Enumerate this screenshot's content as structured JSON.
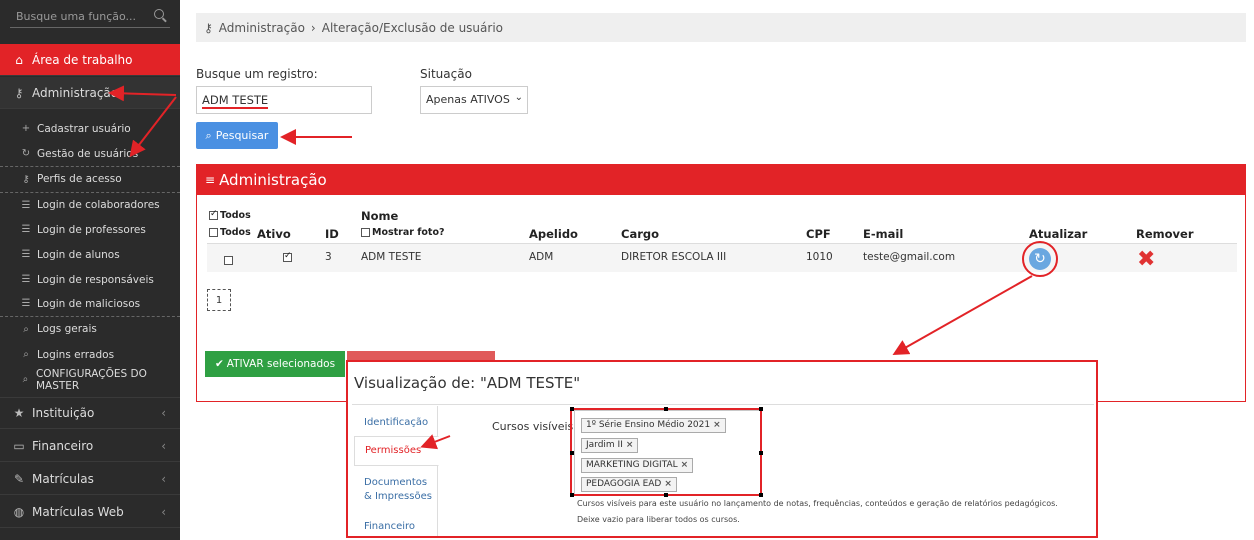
{
  "sidebar": {
    "search_placeholder": "Busque uma função...",
    "items": [
      {
        "label": "Área de trabalho"
      },
      {
        "label": "Administração"
      }
    ],
    "sub_items": [
      {
        "label": "Cadastrar usuário"
      },
      {
        "label": "Gestão de usuários"
      },
      {
        "label": "Perfis de acesso"
      },
      {
        "label": "Login de colaboradores"
      },
      {
        "label": "Login de professores"
      },
      {
        "label": "Login de alunos"
      },
      {
        "label": "Login de responsáveis"
      },
      {
        "label": "Login de maliciosos"
      },
      {
        "label": "Logs gerais"
      },
      {
        "label": "Logins errados"
      },
      {
        "label": "CONFIGURAÇÕES DO MASTER"
      }
    ],
    "bottom_items": [
      {
        "label": "Instituição"
      },
      {
        "label": "Financeiro"
      },
      {
        "label": "Matrículas"
      },
      {
        "label": "Matrículas Web"
      }
    ]
  },
  "breadcrumb": {
    "part1": "Administração",
    "sep": "›",
    "part2": "Alteração/Exclusão de usuário"
  },
  "search": {
    "label": "Busque um registro:",
    "value": "ADM TESTE",
    "button": "Pesquisar"
  },
  "situacao": {
    "label": "Situação",
    "selected": "Apenas ATIVOS"
  },
  "panel": {
    "title": "Administração"
  },
  "table": {
    "todos_top": "Todos",
    "todos": "Todos",
    "headers": {
      "ativo": "Ativo",
      "id": "ID",
      "nome": "Nome",
      "mostrar_foto": "Mostrar foto?",
      "apelido": "Apelido",
      "cargo": "Cargo",
      "cpf": "CPF",
      "email": "E-mail",
      "atualizar": "Atualizar",
      "remover": "Remover"
    },
    "rows": [
      {
        "id": "3",
        "nome": "ADM TESTE",
        "apelido": "ADM",
        "cargo": "DIRETOR ESCOLA III",
        "cpf": "1010",
        "email": "teste@gmail.com"
      }
    ]
  },
  "pager": {
    "page": "1"
  },
  "ativar_button": "ATIVAR selecionados",
  "modal": {
    "title": "Visualização de: \"ADM TESTE\"",
    "tabs": [
      "Identificação",
      "Permissões",
      "Documentos & Impressões",
      "Financeiro"
    ],
    "field_label": "Cursos visíveis",
    "tags": [
      "1º Série Ensino Médio 2021",
      "Jardim II",
      "MARKETING DIGITAL",
      "PEDAGOGIA EAD"
    ],
    "help1": "Cursos visíveis para este usuário no lançamento de notas, frequências, conteúdos e geração de relatórios pedagógicos.",
    "help2": "Deixe vazio para liberar todos os cursos."
  },
  "colors": {
    "accent": "#e22327",
    "blue": "#4a90e2",
    "green": "#2fa043",
    "sidebar": "#2b2b2b"
  }
}
